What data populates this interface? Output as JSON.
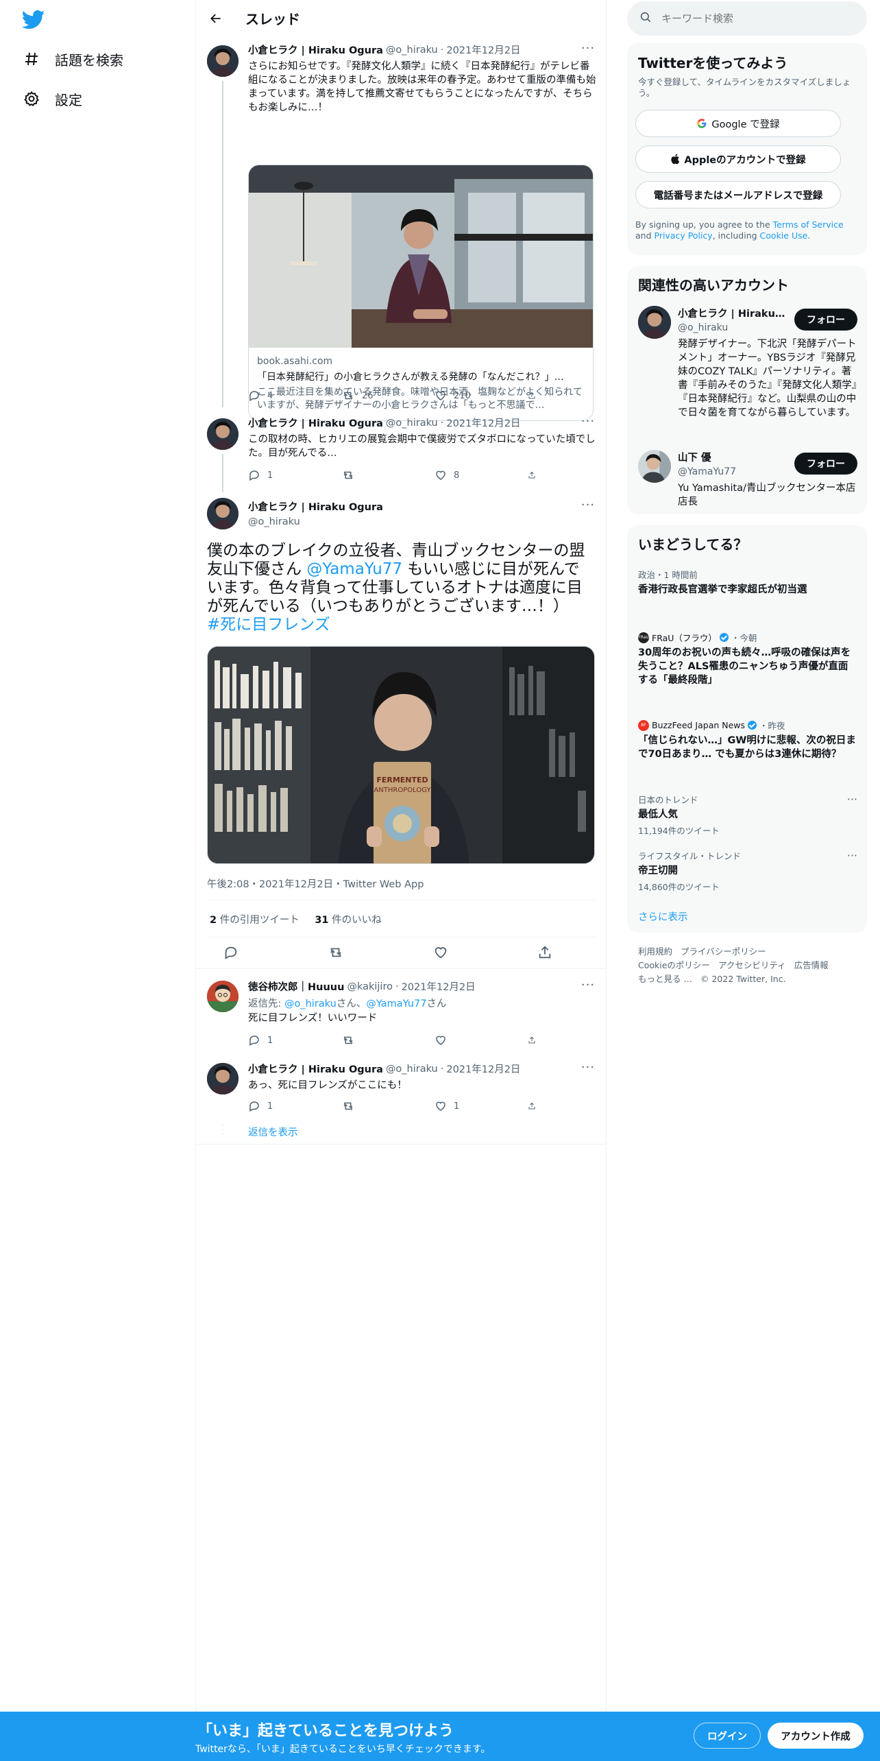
{
  "colors": {
    "accent": "#1d9bf0",
    "text": "#0f1419",
    "muted": "#536471",
    "border": "#eff3f4"
  },
  "nav": {
    "explore": {
      "icon": "hashtag-icon",
      "label": "話題を検索"
    },
    "settings": {
      "icon": "gear-icon",
      "label": "設定"
    }
  },
  "header": {
    "title": "スレッド"
  },
  "tweets": [
    {
      "name": "小倉ヒラク | Hiraku Ogura",
      "handle": "@o_hiraku",
      "date": "2021年12月2日",
      "text": "さらにお知らせです。『発酵文化人類学』に続く『日本発酵紀行』がテレビ番組になることが決まりました。放映は来年の春予定。あわせて重版の準備も始まっています。満を持して推薦文寄せてもらうことになったんですが、そちらもお楽しみに…！",
      "card": {
        "domain": "book.asahi.com",
        "title": "「日本発酵紀行」の小倉ヒラクさんが教える発酵の「なんだこれ？」…",
        "description": "ここ最近注目を集めている発酵食。味噌や日本酒、塩麹などがよく知られていますが、発酵デザイナーの小倉ヒラクさんは「もっと不思議で…"
      },
      "replies": "4",
      "retweets": "26",
      "likes": "210"
    },
    {
      "name": "小倉ヒラク | Hiraku Ogura",
      "handle": "@o_hiraku",
      "date": "2021年12月2日",
      "text": "この取材の時、ヒカリエの展覧会期中で僕疲労でズタボロになっていた頃でした。目が死んでる…",
      "replies": "1",
      "retweets": "",
      "likes": "8"
    }
  ],
  "focus": {
    "name": "小倉ヒラク | Hiraku Ogura",
    "handle": "@o_hiraku",
    "text_1": "僕の本のブレイクの立役者、青山ブックセンターの盟友山下優さん ",
    "mention": "@YamaYu77",
    "text_2": " もいい感じに目が死んでいます。色々背負って仕事しているオトナは適度に目が死んでいる（いつもありがとうございます…！）",
    "hashtag": "#死に目フレンズ",
    "timestamp": "午後2:08・2021年12月2日・Twitter Web App",
    "quote_count": "2",
    "quote_label": "件の引用ツイート",
    "like_count": "31",
    "like_label": "件のいいね"
  },
  "replies": [
    {
      "name": "徳谷柿次郎｜Huuuu",
      "handle": "@kakijiro",
      "date": "2021年12月2日",
      "reply_prefix": "返信先: ",
      "reply_to_1": "@o_hiraku",
      "reply_sep": "さん、",
      "reply_to_2": "@YamaYu77",
      "reply_suffix": "さん",
      "text": "死に目フレンズ！いいワード",
      "replies": "1",
      "retweets": "",
      "likes": ""
    },
    {
      "name": "小倉ヒラク | Hiraku Ogura",
      "handle": "@o_hiraku",
      "date": "2021年12月2日",
      "text": "あっ、死に目フレンズがここにも！",
      "replies": "1",
      "retweets": "",
      "likes": "1"
    }
  ],
  "show_replies": "返信を表示",
  "search": {
    "placeholder": "キーワード検索"
  },
  "signup": {
    "title": "Twitterを使ってみよう",
    "subtitle": "今すぐ登録して、タイムラインをカスタマイズしましょう。",
    "google": "Google で登録",
    "apple": "Appleのアカウントで登録",
    "phone": "電話番号またはメールアドレスで登録",
    "terms_1": "By signing up, you agree to the ",
    "terms_link_1": "Terms of Service",
    "terms_2": " and ",
    "terms_link_2": "Privacy Policy",
    "terms_3": ", including ",
    "terms_link_3": "Cookie Use",
    "terms_4": "."
  },
  "relevant": {
    "title": "関連性の高いアカウント",
    "accounts": [
      {
        "name": "小倉ヒラク | Hiraku ...",
        "handle": "@o_hiraku",
        "bio": "発酵デザイナー。下北沢「発酵デパートメント」オーナー。YBSラジオ『発酵兄妹のCOZY TALK』パーソナリティ。著書『手前みそのうた』『発酵文化人類学』『日本発酵紀行』など。山梨県の山の中で日々菌を育てながら暮らしています。",
        "follow": "フォロー"
      },
      {
        "name": "山下 優",
        "handle": "@YamaYu77",
        "bio": "Yu Yamashita/青山ブックセンター本店 店長",
        "follow": "フォロー"
      }
    ]
  },
  "trends": {
    "title": "いまどうしてる？",
    "items": [
      {
        "context": "政治・1 時間前",
        "title": "香港行政長官選挙で李家超氏が初当選"
      },
      {
        "source": "FRaU（フラウ）",
        "time": "・今朝",
        "title": "30周年のお祝いの声も続々…呼吸の確保は声を失うこと？ALS罹患のニャンちゅう声優が直面する「最終段階」"
      },
      {
        "source": "BuzzFeed Japan News",
        "time": "・昨夜",
        "title": "「信じられない…」GW明けに悲報、次の祝日まで70日あまり… でも夏からは3連休に期待？"
      },
      {
        "context": "日本のトレンド",
        "title": "最低人気",
        "count": "11,194件のツイート"
      },
      {
        "context": "ライフスタイル・トレンド",
        "title": "帝王切開",
        "count": "14,860件のツイート"
      }
    ],
    "show_more": "さらに表示"
  },
  "footer": {
    "links": [
      "利用規約",
      "プライバシーポリシー",
      "Cookieのポリシー",
      "アクセシビリティ",
      "広告情報",
      "もっと見る …"
    ],
    "copyright": "© 2022 Twitter, Inc."
  },
  "bottom_bar": {
    "title": "「いま」起きていることを見つけよう",
    "subtitle": "Twitterなら、「いま」起きていることをいち早くチェックできます。",
    "login": "ログイン",
    "signup": "アカウント作成"
  }
}
